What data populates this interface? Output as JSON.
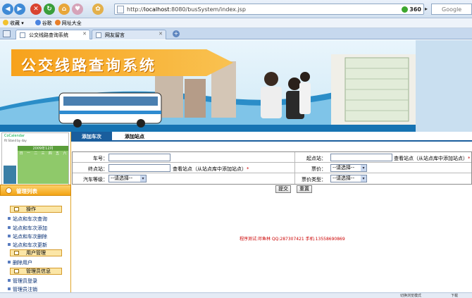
{
  "browser": {
    "url_prefix": "http://",
    "url_host": "localhost",
    "url_rest": ":8080/busSystem/index.jsp",
    "badge_360": "360",
    "search_placeholder": "Google",
    "bookmarks": [
      "收藏",
      "谷歌",
      "网址大全"
    ],
    "tabs": [
      {
        "label": "公交线路查询系统",
        "active": true
      },
      {
        "label": "网友留言",
        "active": false
      }
    ]
  },
  "banner": {
    "title": "公交线路查询系统"
  },
  "calendar": {
    "title": "CoCalendar",
    "subtitle": "fit Stand by day",
    "month_label": "2009年12月",
    "weekdays": [
      "日",
      "一",
      "二",
      "三",
      "四",
      "五",
      "六"
    ]
  },
  "sidebar": {
    "heading": "管理列表",
    "sections": [
      {
        "label": "操作",
        "items": [
          "站点和车次查询",
          "站点和车次添加",
          "站点和车次删除",
          "站点和车次更新"
        ]
      },
      {
        "label": "用户管理",
        "items": [
          "删除用户"
        ]
      },
      {
        "label": "管理员信息",
        "items": [
          "管理员登录",
          "管理员注销"
        ]
      }
    ]
  },
  "subtabs": [
    "添加车次",
    "添加站点"
  ],
  "form": {
    "car_no_label": "车号：",
    "start_label": "起点站：",
    "end_label": "终点站：",
    "view_stations": "查看站点（从站点库中添加站点）",
    "required_mark": "*",
    "price_label": "票价：",
    "grade_label": "汽车等级：",
    "price_type_label": "票价类型：",
    "select_default": "--请选择--",
    "submit": "提交",
    "reset": "重置"
  },
  "footer": {
    "test_credit": "程序测试:邓鱼林 QQ:287307421 手机:13558690869"
  },
  "status": {
    "mode_text": "切换浏览模式",
    "download_text": "下载"
  },
  "colors": {
    "accent_blue": "#1a5e9d",
    "orange": "#f3a415",
    "credit_red": "#cc0000"
  }
}
